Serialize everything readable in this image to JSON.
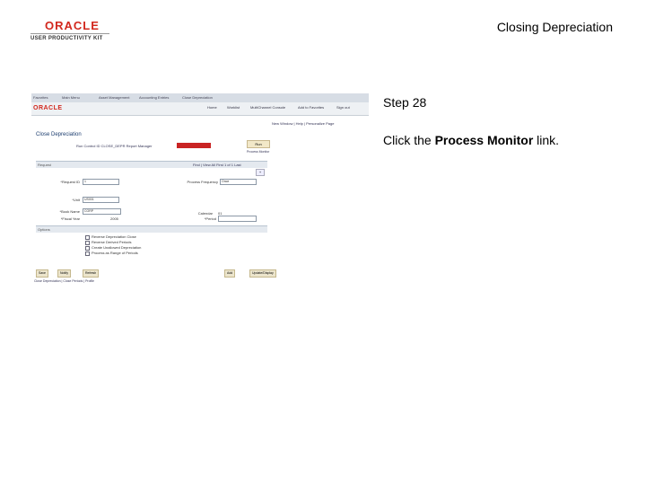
{
  "header": {
    "logo_brand": "ORACLE",
    "logo_product": "USER PRODUCTIVITY KIT",
    "title": "Closing Depreciation"
  },
  "screenshot": {
    "topbar": [
      "Favorites",
      "Main Menu",
      "Asset Management",
      "Accounting Entries",
      "Close Depreciation"
    ],
    "header_links": [
      "Home",
      "Worklist",
      "MultiChannel Console",
      "Add to Favorites",
      "Sign out"
    ],
    "brand": "ORACLE",
    "util_links": "New Window | Help | Personalize Page",
    "component_title": "Close Depreciation",
    "run_control": "Run Control ID  CLOSE_DEPR   Report Manager",
    "run_button": "Run",
    "process_monitor_link": "Process Monitor",
    "region_1": "Request",
    "nav_text": "Find | View All     First  1 of 1  Last",
    "labels": {
      "request_id": "*Request ID",
      "process_frequency": "Process Frequency",
      "unit": "*Unit",
      "book_name": "*Book Name",
      "fiscal_year": "*Fiscal Year",
      "calendar": "Calendar",
      "period": "*Period"
    },
    "values": {
      "request_id": "1",
      "process_frequency": "Once",
      "unit": "US001",
      "book_name": "CORP",
      "fiscal_year": "2005",
      "calendar": "01"
    },
    "region_2": "Options",
    "options": [
      "Reverse Depreciation Close",
      "Reverse Derived Periods",
      "Create Unallowed Depreciation",
      "Process as Range of Periods"
    ],
    "buttons": [
      "Save",
      "Notify",
      "Refresh",
      "Add",
      "Update/Display"
    ],
    "footer": "Close Depreciation | Close Periods | Profile"
  },
  "step": {
    "label": "Step 28",
    "instruction_before": "Click the ",
    "instruction_bold": "Process Monitor",
    "instruction_after": " link."
  }
}
